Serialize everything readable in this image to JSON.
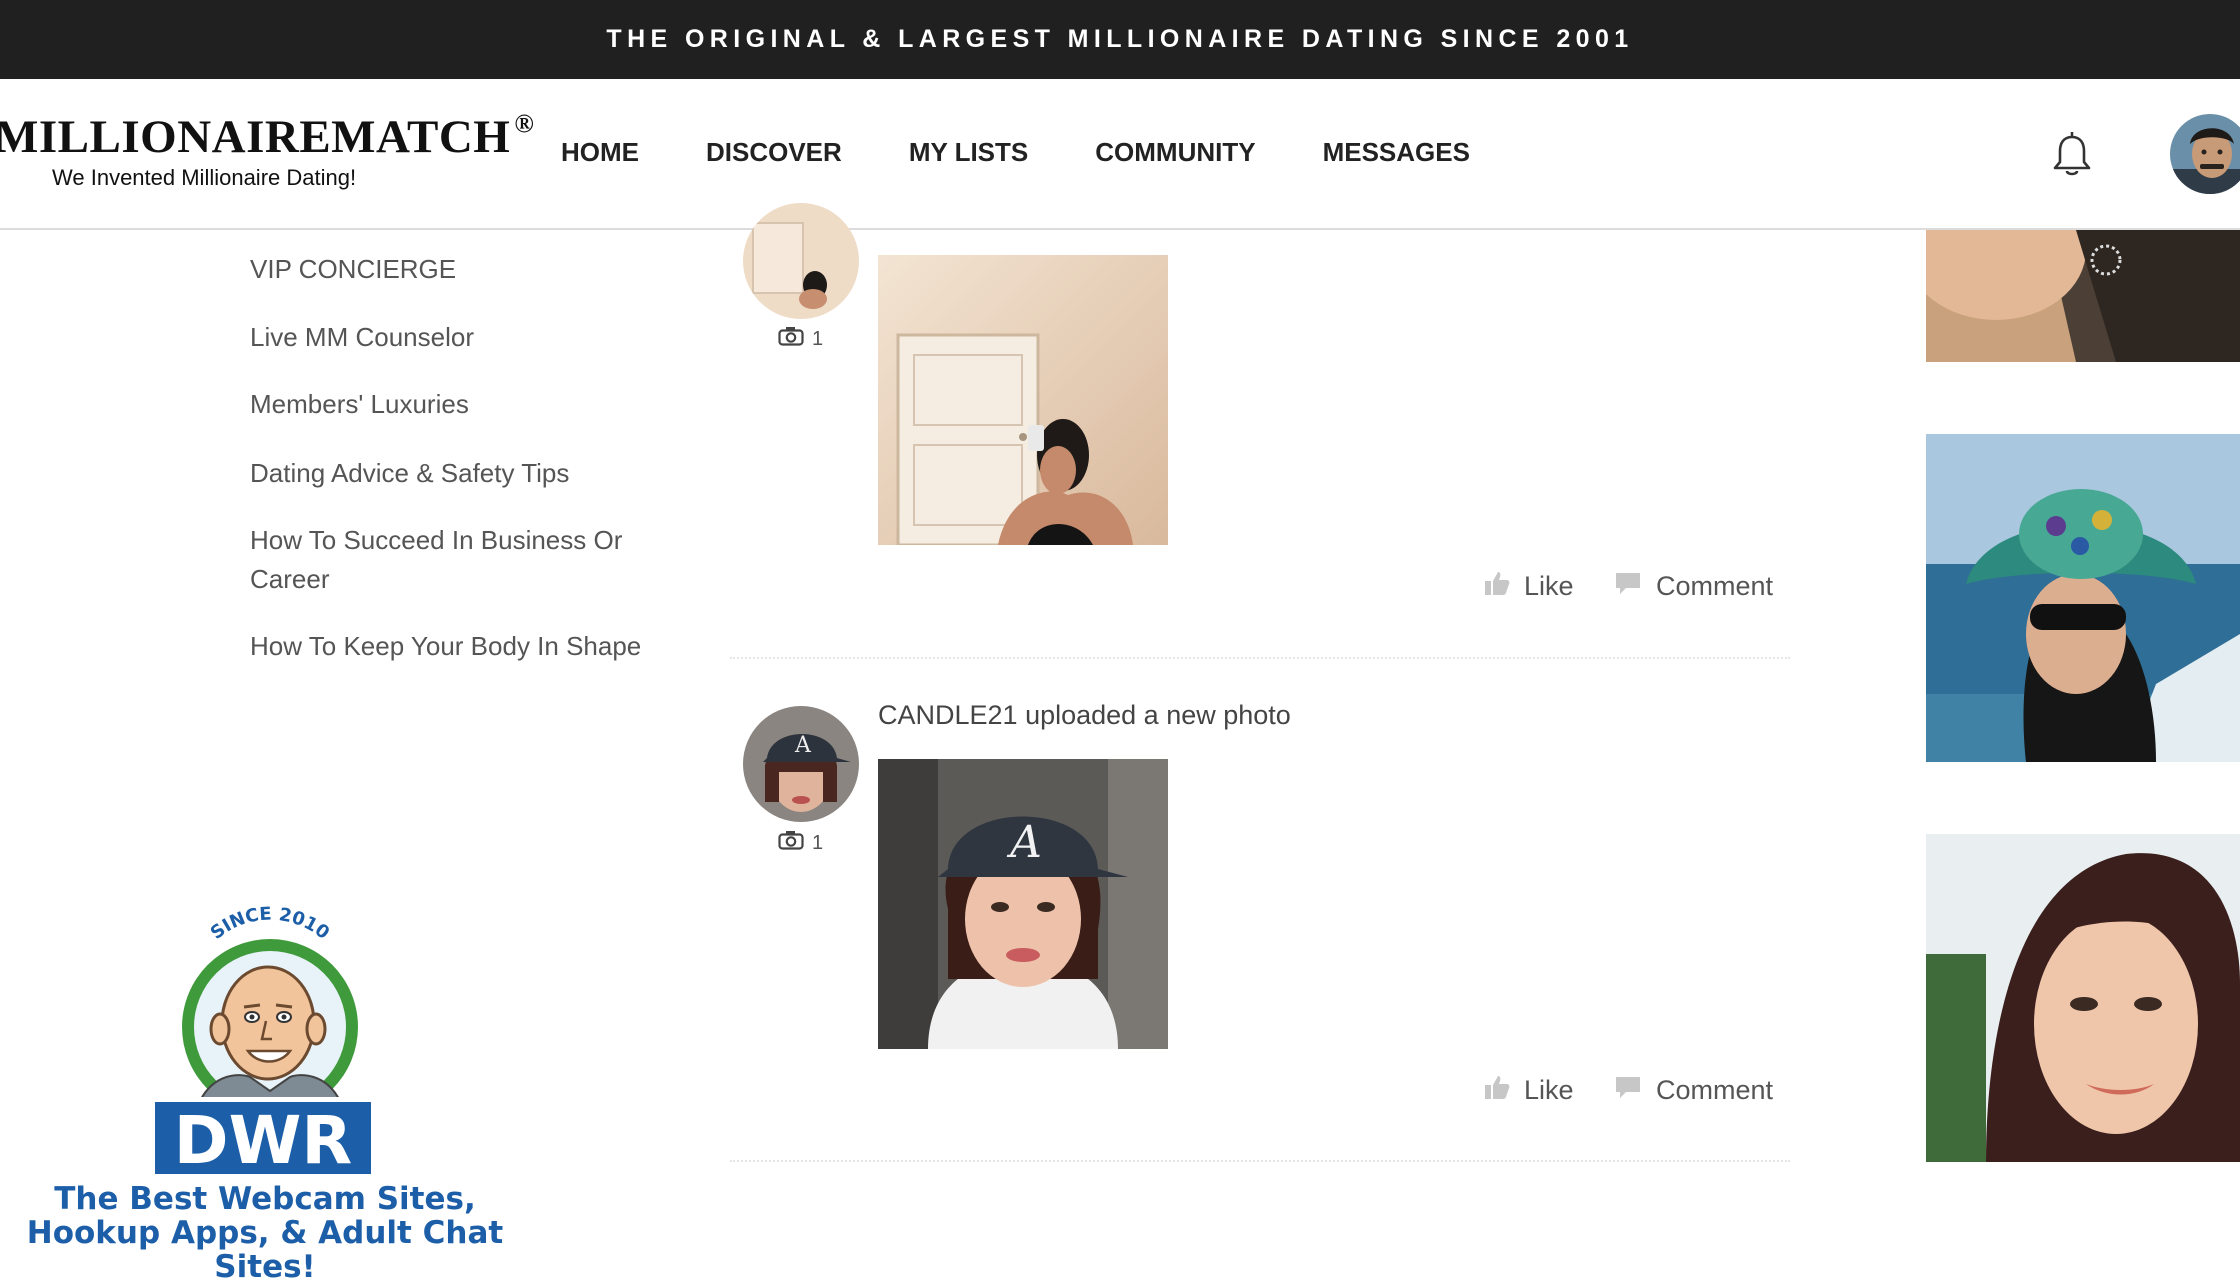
{
  "banner": {
    "text": "THE ORIGINAL & LARGEST MILLIONAIRE DATING SINCE 2001"
  },
  "header": {
    "logo": "MILLIONAIREMATCH",
    "logo_mark": "®",
    "tagline": "We Invented Millionaire Dating!",
    "nav": [
      "HOME",
      "DISCOVER",
      "MY LISTS",
      "COMMUNITY",
      "MESSAGES"
    ],
    "icons": [
      "bell-icon",
      "user-avatar"
    ]
  },
  "sidebar": {
    "items": [
      "VIP CONCIERGE",
      "Live MM Counselor",
      "Members' Luxuries",
      "Dating Advice & Safety Tips",
      "How To Succeed In Business Or Career",
      "How To Keep Your Body In Shape"
    ]
  },
  "dwr": {
    "since": "SINCE 2010",
    "logo": "DWR",
    "line1": "The Best Webcam Sites,",
    "line2": "Hookup Apps, & Adult Chat Sites!"
  },
  "feed": {
    "posts": [
      {
        "title": "",
        "photo_count": "1",
        "like_label": "Like",
        "comment_label": "Comment"
      },
      {
        "title": "CANDLE21 uploaded a new photo",
        "photo_count": "1",
        "like_label": "Like",
        "comment_label": "Comment"
      }
    ]
  },
  "colors": {
    "banner_bg": "#202020",
    "banner_text": "#ffffff",
    "dwr_blue": "#1c5ea8",
    "dwr_green": "#3f9a3c"
  }
}
